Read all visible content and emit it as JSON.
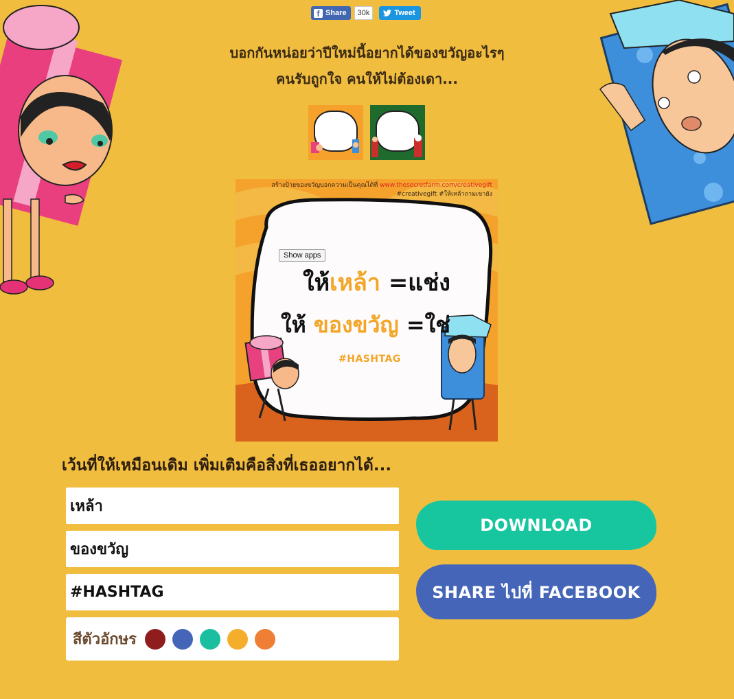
{
  "social": {
    "share_label": "Share",
    "share_count": "30k",
    "tweet_label": "Tweet"
  },
  "headline": {
    "line1": "บอกกันหน่อยว่าปีใหม่นี้อยากได้ของขวัญอะไรๆ",
    "line2": "คนรับถูกใจ คนให้ไม่ต้องเดา..."
  },
  "preview": {
    "header_text": "สร้างป้ายของขวัญบอกความเป็นคุณได้ที่",
    "header_url": "www.thesecretfarm.com/creativegift",
    "header_tags": "#creativegift #ให้เหล้าถามเขายัง",
    "show_apps": "Show apps",
    "line1_prefix": "ให้",
    "line1_word": "เหล้า",
    "line1_suffix": " =แช่ง",
    "line2_prefix": "ให้ ",
    "line2_word": "ของขวัญ",
    "line2_suffix": " =ใช่",
    "hashtag": "#HASHTAG"
  },
  "form": {
    "subheading": "เว้นที่ให้เหมือนเดิม เพิ่มเติมคือสิ่งที่เธออยากได้...",
    "field1_value": "เหล้า",
    "field2_value": "ของขวัญ",
    "field3_value": "#HASHTAG",
    "colors_label": "สีตัวอักษร",
    "colors": [
      "#8f1d1d",
      "#4566b8",
      "#1bbfa0",
      "#f5ad2c",
      "#ee7f35"
    ]
  },
  "buttons": {
    "download": "DOWNLOAD",
    "share_facebook": "SHARE ไปที่ FACEBOOK"
  }
}
